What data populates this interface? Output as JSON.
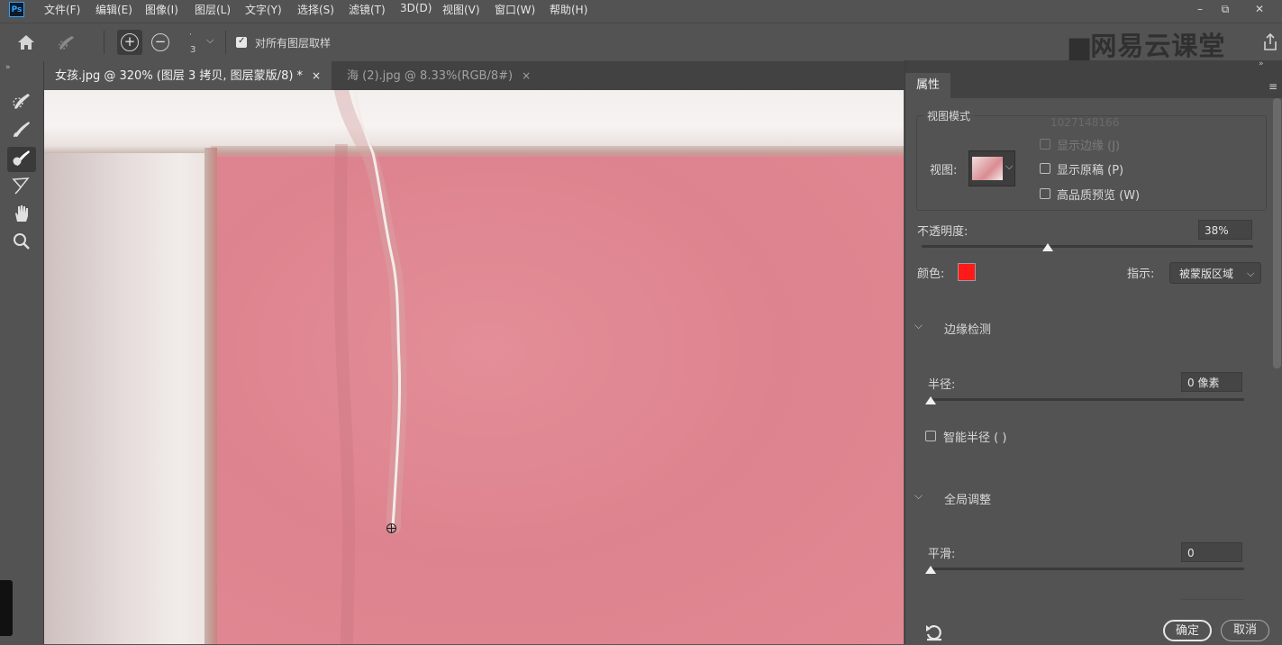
{
  "app": {
    "logo": "Ps"
  },
  "menu": [
    "文件(F)",
    "编辑(E)",
    "图像(I)",
    "图层(L)",
    "文字(Y)",
    "选择(S)",
    "滤镜(T)",
    "3D(D)",
    "视图(V)",
    "窗口(W)",
    "帮助(H)"
  ],
  "window_controls": {
    "minimize": "–",
    "restore": "⧉",
    "close": "✕"
  },
  "options": {
    "brush_size_top": "·",
    "brush_size": "3",
    "sample_all_label": "对所有图层取样",
    "sample_all_checked": true
  },
  "watermark": "网易云课堂",
  "tabs": [
    {
      "label": "女孩.jpg @ 320% (图层 3 拷贝, 图层蒙版/8) *",
      "close": "×",
      "active": true
    },
    {
      "label": "海 (2).jpg @ 8.33%(RGB/8#)",
      "close": "×",
      "active": false
    }
  ],
  "panel": {
    "tab_label": "属性",
    "collapse_arrows": "»",
    "view_mode": {
      "title": "视图模式",
      "overlay_number": "1027148166",
      "view_label": "视图:",
      "show_edge": "显示边缘 (J)",
      "show_original": "显示原稿 (P)",
      "hq_preview": "高品质预览 (W)"
    },
    "opacity": {
      "label": "不透明度:",
      "value": "38%",
      "fraction": 0.38
    },
    "color": {
      "label": "颜色:",
      "swatch": "#ff1a1a"
    },
    "indicate": {
      "label": "指示:",
      "value": "被蒙版区域"
    },
    "edge_detection": {
      "title": "边缘检测",
      "radius_label": "半径:",
      "radius_value": "0 像素",
      "smart_radius": "智能半径 (  )"
    },
    "global": {
      "title": "全局调整",
      "smooth_label": "平滑:",
      "smooth_value": "0"
    },
    "ok": "确定",
    "cancel": "取消"
  }
}
